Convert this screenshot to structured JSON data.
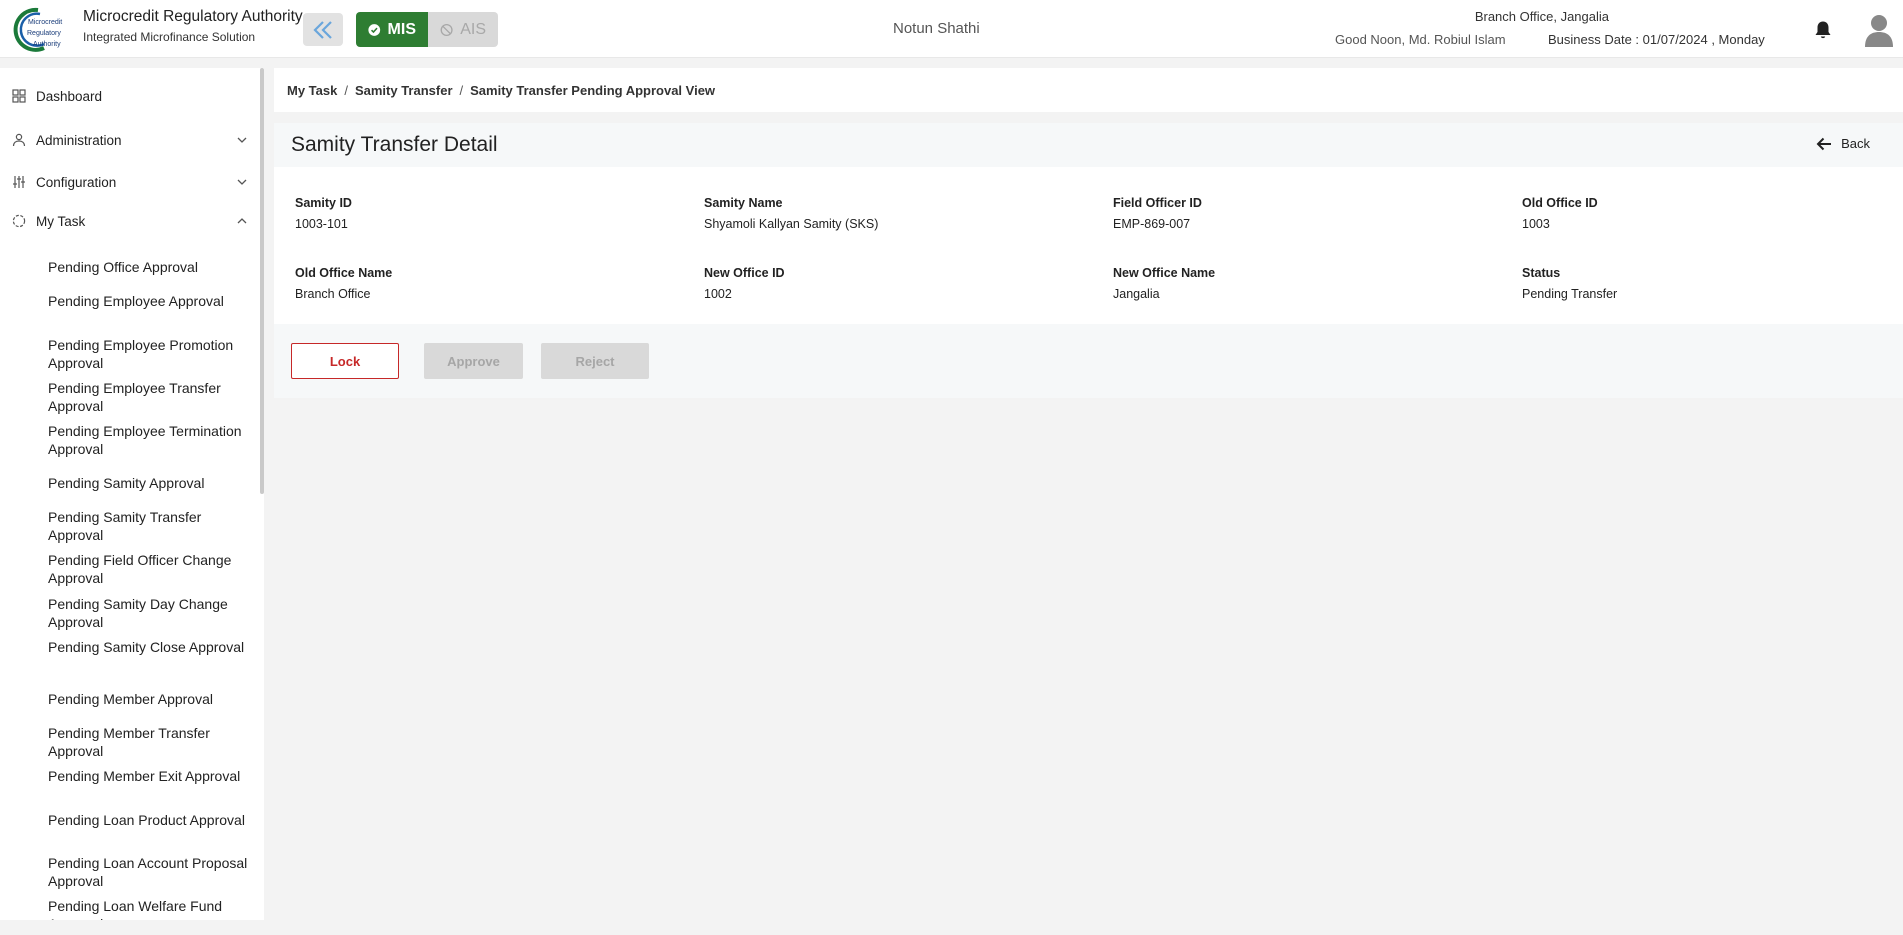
{
  "header": {
    "brand_title": "Microcredit Regulatory Authority",
    "brand_subtitle": "Integrated Microfinance Solution",
    "logo_text": [
      "Microcredit",
      "Regulatory",
      "Authority"
    ],
    "mode_mis": "MIS",
    "mode_ais": "AIS",
    "center_name": "Notun Shathi",
    "greeting": "Good Noon, Md. Robiul Islam",
    "branch": "Branch Office, Jangalia",
    "business_date": "Business Date : 01/07/2024 , Monday",
    "accent_color": "#2e7d32"
  },
  "sidebar": {
    "top_items": [
      {
        "label": "Dashboard",
        "icon": "grid-icon"
      },
      {
        "label": "Administration",
        "icon": "users-icon"
      },
      {
        "label": "Configuration",
        "icon": "sliders-icon"
      },
      {
        "label": "My Task",
        "icon": "task-icon"
      }
    ],
    "sub_items": [
      "Pending Office Approval",
      "Pending Employee Approval",
      "Pending Employee Promotion Approval",
      "Pending Employee Transfer Approval",
      "Pending Employee Termination Approval",
      "Pending Samity Approval",
      "Pending Samity Transfer Approval",
      "Pending Field Officer Change Approval",
      "Pending Samity Day Change Approval",
      "Pending Samity Close Approval",
      "Pending Member Approval",
      "Pending Member Transfer Approval",
      "Pending Member Exit Approval",
      "Pending Loan Product Approval",
      "Pending Loan Account Proposal Approval",
      "Pending Loan Welfare Fund Approval"
    ]
  },
  "breadcrumb": [
    "My Task",
    "Samity Transfer",
    "Samity Transfer Pending Approval View"
  ],
  "detail": {
    "title": "Samity Transfer Detail",
    "back_label": "Back",
    "fields": [
      {
        "label": "Samity ID",
        "value": "1003-101"
      },
      {
        "label": "Samity Name",
        "value": "Shyamoli Kallyan Samity (SKS)"
      },
      {
        "label": "Field Officer ID",
        "value": "EMP-869-007"
      },
      {
        "label": "Old Office ID",
        "value": "1003"
      },
      {
        "label": "Old Office Name",
        "value": "Branch Office"
      },
      {
        "label": "New Office ID",
        "value": "1002"
      },
      {
        "label": "New Office Name",
        "value": "Jangalia"
      },
      {
        "label": "Status",
        "value": "Pending Transfer"
      }
    ]
  },
  "actions": {
    "lock": "Lock",
    "approve": "Approve",
    "reject": "Reject"
  }
}
